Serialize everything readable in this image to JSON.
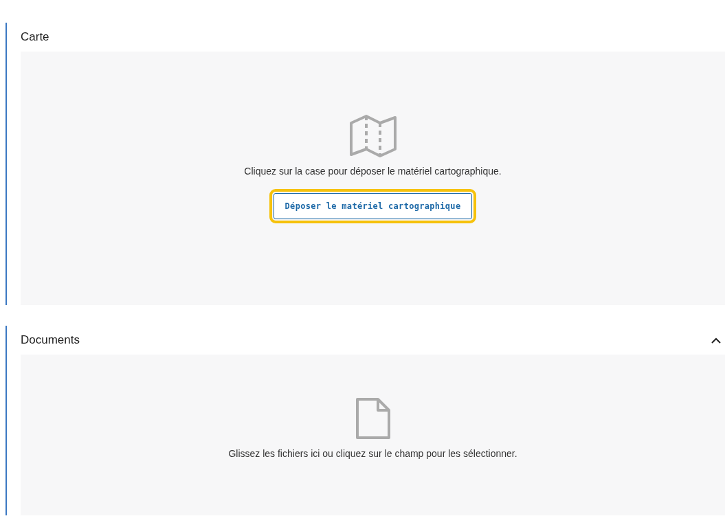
{
  "sections": [
    {
      "kind": "map",
      "title": "Carte",
      "message": "Cliquez sur la case pour déposer le matériel cartographique.",
      "button": {
        "label": "Déposer le matériel cartographique",
        "focused": true
      }
    },
    {
      "kind": "documents",
      "title": "Documents",
      "expanded": true,
      "message": "Glissez les fichiers ici ou cliquez sur le champ pour les sélectionner."
    }
  ]
}
